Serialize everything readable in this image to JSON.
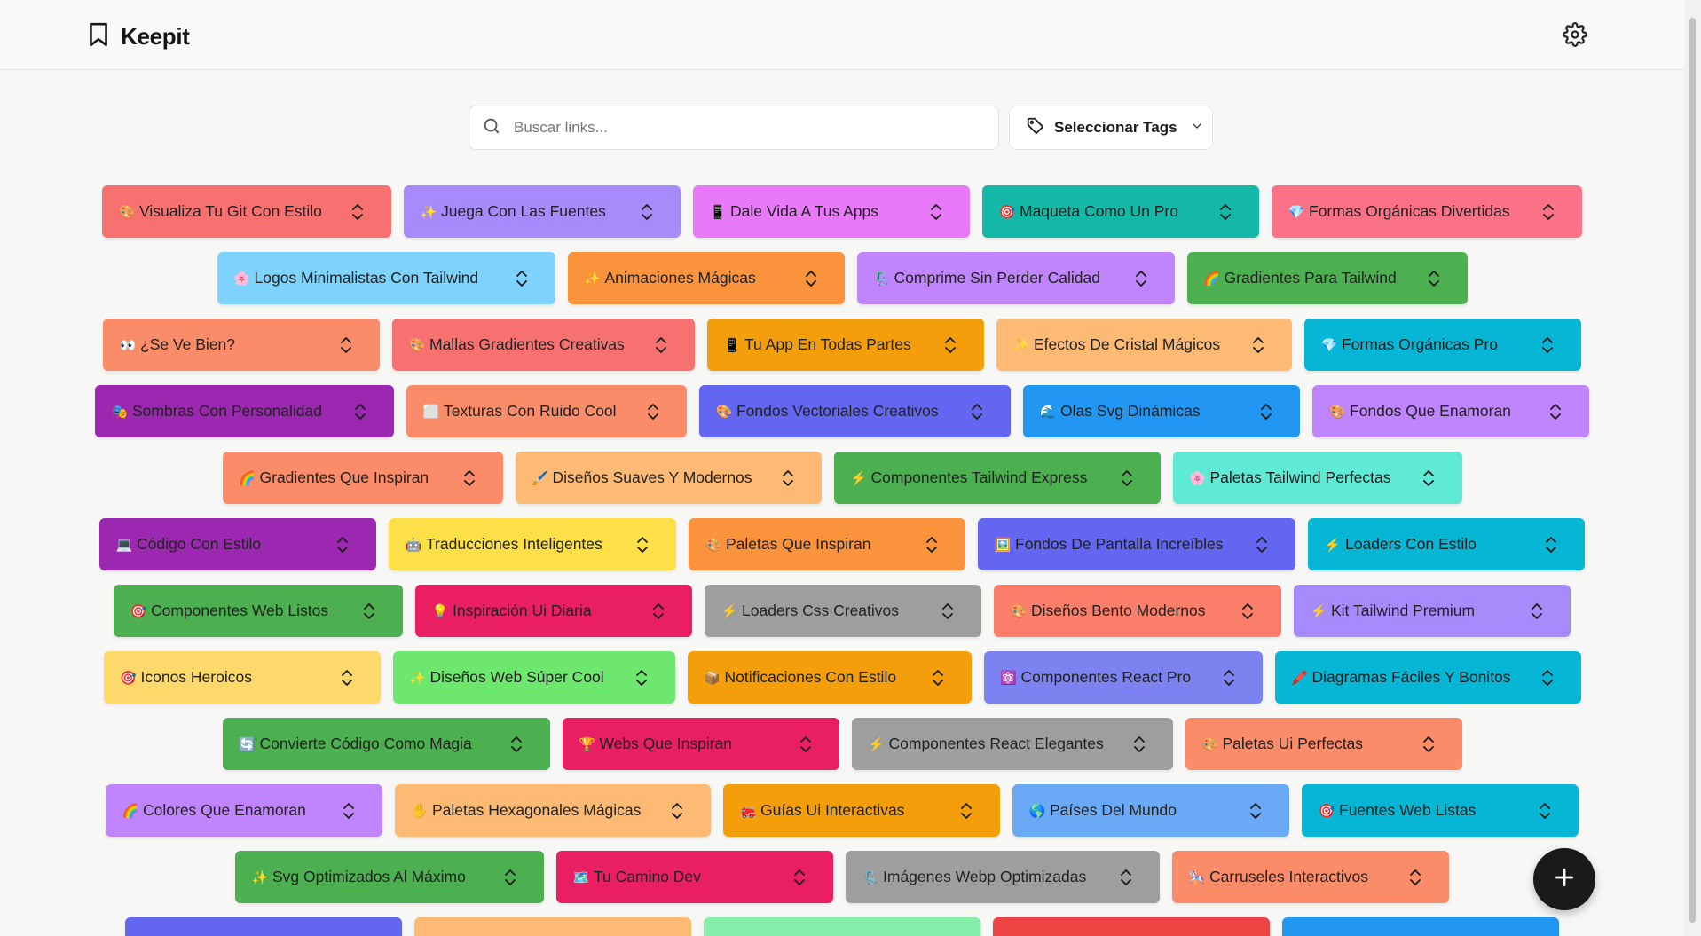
{
  "app": {
    "title": "Keepit"
  },
  "search": {
    "placeholder": "Buscar links...",
    "value": ""
  },
  "tags_button": {
    "label": "Seleccionar Tags"
  },
  "icons": {
    "logo": "bookmark-icon",
    "settings": "gear-icon",
    "search": "search-icon",
    "tags": "tag-icon",
    "dropdown": "chevron-down-icon",
    "chip_sort": "chevrons-up-down-icon",
    "add": "plus-icon"
  },
  "rows": [
    [
      {
        "emoji": "🎨",
        "label": "Visualiza Tu Git Con Estilo",
        "color": "#f87171",
        "w": 326
      },
      {
        "emoji": "✨",
        "label": "Juega Con Las Fuentes",
        "color": "#a78bfa",
        "w": 312
      },
      {
        "emoji": "📱",
        "label": "Dale Vida A Tus Apps",
        "color": "#e879f9",
        "w": 312
      },
      {
        "emoji": "🎯",
        "label": "Maqueta Como Un Pro",
        "color": "#14b8a6",
        "w": 312
      },
      {
        "emoji": "💎",
        "label": "Formas Orgánicas Divertidas",
        "color": "#fb7185",
        "w": 350
      }
    ],
    [
      {
        "emoji": "🌸",
        "label": "Logos Minimalistas Con Tailwind",
        "color": "#7dd3fc",
        "w": 381
      },
      {
        "emoji": "✨",
        "label": "Animaciones Mágicas",
        "color": "#fb923c",
        "w": 312
      },
      {
        "emoji": "🗜️",
        "label": "Comprime Sin Perder Calidad",
        "color": "#c084fc",
        "w": 358
      },
      {
        "emoji": "🌈",
        "label": "Gradientes Para Tailwind",
        "color": "#4caf50",
        "w": 316
      }
    ],
    [
      {
        "emoji": "👀",
        "label": "¿Se Ve Bien?",
        "color": "#fb8c6a",
        "w": 312
      },
      {
        "emoji": "🎨",
        "label": "Mallas Gradientes Creativas",
        "color": "#f87171",
        "w": 341
      },
      {
        "emoji": "📱",
        "label": "Tu App En Todas Partes",
        "color": "#f59e0b",
        "w": 312
      },
      {
        "emoji": "✨",
        "label": "Efectos De Cristal Mágicos",
        "color": "#fdba74",
        "w": 333
      },
      {
        "emoji": "💎",
        "label": "Formas Orgánicas Pro",
        "color": "#06b6d4",
        "w": 312
      }
    ],
    [
      {
        "emoji": "🎭",
        "label": "Sombras Con Personalidad",
        "color": "#9c27b0",
        "w": 337
      },
      {
        "emoji": "⬜",
        "label": "Texturas Con Ruido Cool",
        "color": "#fb8c6a",
        "w": 316
      },
      {
        "emoji": "🎨",
        "label": "Fondos Vectoriales Creativos",
        "color": "#6366f1",
        "w": 351
      },
      {
        "emoji": "🌊",
        "label": "Olas Svg Dinámicas",
        "color": "#2196f3",
        "w": 312
      },
      {
        "emoji": "🎨",
        "label": "Fondos Que Enamoran",
        "color": "#c084fc",
        "w": 312
      }
    ],
    [
      {
        "emoji": "🌈",
        "label": "Gradientes Que Inspiran",
        "color": "#fb8c6a",
        "w": 316
      },
      {
        "emoji": "🖌️",
        "label": "Diseños Suaves Y Modernos",
        "color": "#fdba74",
        "w": 345
      },
      {
        "emoji": "⚡",
        "label": "Componentes Tailwind Express",
        "color": "#4caf50",
        "w": 368
      },
      {
        "emoji": "🌸",
        "label": "Paletas Tailwind Perfectas",
        "color": "#5eead4",
        "w": 326
      }
    ],
    [
      {
        "emoji": "💻",
        "label": "Código Con Estilo",
        "color": "#9c27b0",
        "w": 312
      },
      {
        "emoji": "🤖",
        "label": "Traducciones Inteligentes",
        "color": "#fde047",
        "w": 324
      },
      {
        "emoji": "🎨",
        "label": "Paletas Que Inspiran",
        "color": "#fb923c",
        "w": 312
      },
      {
        "emoji": "🖼️",
        "label": "Fondos De Pantalla Increíbles",
        "color": "#6366f1",
        "w": 358
      },
      {
        "emoji": "⚡",
        "label": "Loaders Con Estilo",
        "color": "#06b6d4",
        "w": 312
      }
    ],
    [
      {
        "emoji": "🎯",
        "label": "Componentes Web Listos",
        "color": "#4caf50",
        "w": 326
      },
      {
        "emoji": "💡",
        "label": "Inspiración Ui Diaria",
        "color": "#e91e63",
        "w": 312
      },
      {
        "emoji": "⚡",
        "label": "Loaders Css Creativos",
        "color": "#9e9e9e",
        "w": 312
      },
      {
        "emoji": "🎨",
        "label": "Diseños Bento Modernos",
        "color": "#fb7e6a",
        "w": 324
      },
      {
        "emoji": "⚡",
        "label": "Kit Tailwind Premium",
        "color": "#a78bfa",
        "w": 312
      }
    ],
    [
      {
        "emoji": "🎯",
        "label": "Iconos Heroicos",
        "color": "#fcd96a",
        "w": 312
      },
      {
        "emoji": "✨",
        "label": "Diseños Web Súper Cool",
        "color": "#6ee76e",
        "w": 318
      },
      {
        "emoji": "📦",
        "label": "Notificaciones Con Estilo",
        "color": "#f59e0b",
        "w": 320
      },
      {
        "emoji": "⚛️",
        "label": "Componentes React Pro",
        "color": "#7c83f0",
        "w": 314
      },
      {
        "emoji": "🖍️",
        "label": "Diagramas Fáciles Y Bonitos",
        "color": "#06b6d4",
        "w": 345
      }
    ],
    [
      {
        "emoji": "🔄",
        "label": "Convierte Código Como Magia",
        "color": "#4caf50",
        "w": 369
      },
      {
        "emoji": "🏆",
        "label": "Webs Que Inspiran",
        "color": "#e91e63",
        "w": 312
      },
      {
        "emoji": "⚡",
        "label": "Componentes React Elegantes",
        "color": "#9e9e9e",
        "w": 362
      },
      {
        "emoji": "🎨",
        "label": "Paletas Ui Perfectas",
        "color": "#fb8c6a",
        "w": 312
      }
    ],
    [
      {
        "emoji": "🌈",
        "label": "Colores Que Enamoran",
        "color": "#c084fc",
        "w": 312
      },
      {
        "emoji": "✋",
        "label": "Paletas Hexagonales Mágicas",
        "color": "#fdba74",
        "w": 356
      },
      {
        "emoji": "🚒",
        "label": "Guías Ui Interactivas",
        "color": "#f59e0b",
        "w": 312
      },
      {
        "emoji": "🌎",
        "label": "Países Del Mundo",
        "color": "#6aa9f5",
        "w": 312
      },
      {
        "emoji": "🎯",
        "label": "Fuentes Web Listas",
        "color": "#06b6d4",
        "w": 312
      }
    ],
    [
      {
        "emoji": "✨",
        "label": "Svg Optimizados Al Máximo",
        "color": "#4caf50",
        "w": 348
      },
      {
        "emoji": "🗺️",
        "label": "Tu Camino Dev",
        "color": "#e91e63",
        "w": 312
      },
      {
        "emoji": "🗜️",
        "label": "Imágenes Webp Optimizadas",
        "color": "#9e9e9e",
        "w": 354
      },
      {
        "emoji": "🎠",
        "label": "Carruseles Interactivos",
        "color": "#fb8c6a",
        "w": 312
      }
    ],
    [
      {
        "emoji": "",
        "label": "",
        "color": "#6366f1",
        "w": 312
      },
      {
        "emoji": "",
        "label": "",
        "color": "#fdba74",
        "w": 312
      },
      {
        "emoji": "",
        "label": "",
        "color": "#86efac",
        "w": 312
      },
      {
        "emoji": "",
        "label": "",
        "color": "#ef4444",
        "w": 312
      },
      {
        "emoji": "",
        "label": "",
        "color": "#2196f3",
        "w": 312
      }
    ]
  ]
}
